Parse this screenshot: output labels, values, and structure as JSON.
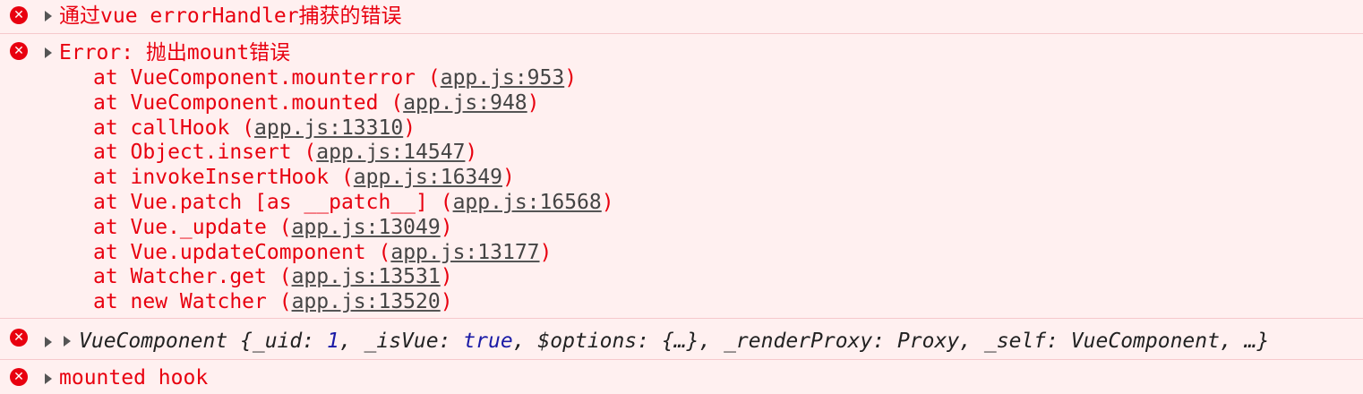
{
  "messages": {
    "m1": {
      "text": "通过vue errorHandler捕获的错误",
      "icon": "error-icon"
    },
    "m2": {
      "header": "Error: 抛出mount错误",
      "icon": "error-icon",
      "stack": [
        {
          "prefix": "at VueComponent.mounterror (",
          "link": "app.js:953",
          "suffix": ")"
        },
        {
          "prefix": "at VueComponent.mounted (",
          "link": "app.js:948",
          "suffix": ")"
        },
        {
          "prefix": "at callHook (",
          "link": "app.js:13310",
          "suffix": ")"
        },
        {
          "prefix": "at Object.insert (",
          "link": "app.js:14547",
          "suffix": ")"
        },
        {
          "prefix": "at invokeInsertHook (",
          "link": "app.js:16349",
          "suffix": ")"
        },
        {
          "prefix": "at Vue.patch [as __patch__] (",
          "link": "app.js:16568",
          "suffix": ")"
        },
        {
          "prefix": "at Vue._update (",
          "link": "app.js:13049",
          "suffix": ")"
        },
        {
          "prefix": "at Vue.updateComponent (",
          "link": "app.js:13177",
          "suffix": ")"
        },
        {
          "prefix": "at Watcher.get (",
          "link": "app.js:13531",
          "suffix": ")"
        },
        {
          "prefix": "at new Watcher (",
          "link": "app.js:13520",
          "suffix": ")"
        }
      ]
    },
    "m3": {
      "icon": "error-icon",
      "p1": "VueComponent {_uid: ",
      "v1": "1",
      "p2": ", _isVue: ",
      "v2": "true",
      "p3": ", $options: {…}, _renderProxy: Proxy, _self: VueComponent, …}"
    },
    "m4": {
      "text": "mounted hook",
      "icon": "error-icon"
    }
  },
  "colors": {
    "error_text": "#e8000f",
    "background": "#fff0f0",
    "link": "#444444",
    "keyword": "#1a1aa6"
  }
}
